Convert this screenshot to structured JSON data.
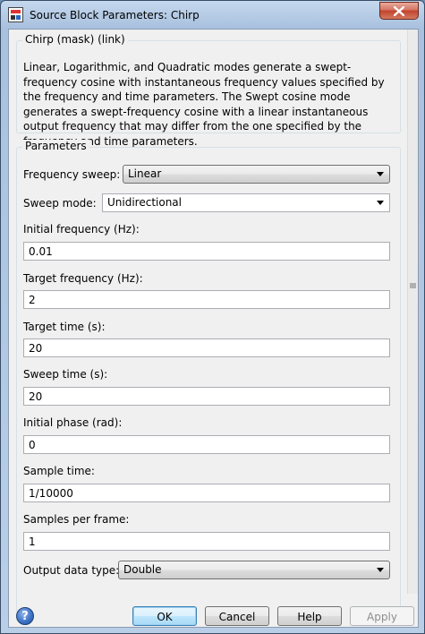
{
  "window": {
    "title": "Source Block Parameters: Chirp",
    "close_label": "×"
  },
  "mask": {
    "legend": "Chirp (mask) (link)",
    "description": "Linear, Logarithmic, and Quadratic modes generate a swept-frequency cosine with instantaneous frequency values specified by the frequency and time parameters.   The Swept cosine mode generates a swept-frequency cosine with a linear instantaneous output frequency that may differ from the one specified by the frequency and time parameters."
  },
  "parameters": {
    "legend": "Parameters",
    "frequency_sweep": {
      "label": "Frequency sweep:",
      "value": "Linear"
    },
    "sweep_mode": {
      "label": "Sweep mode:",
      "value": "Unidirectional"
    },
    "initial_frequency": {
      "label": "Initial frequency (Hz):",
      "value": "0.01"
    },
    "target_frequency": {
      "label": "Target frequency (Hz):",
      "value": "2"
    },
    "target_time": {
      "label": "Target time (s):",
      "value": "20"
    },
    "sweep_time": {
      "label": "Sweep time (s):",
      "value": "20"
    },
    "initial_phase": {
      "label": "Initial phase (rad):",
      "value": "0"
    },
    "sample_time": {
      "label": "Sample time:",
      "value": "1/10000"
    },
    "samples_per_frame": {
      "label": "Samples per frame:",
      "value": "1"
    },
    "output_data_type": {
      "label": "Output data type:",
      "value": "Double"
    }
  },
  "buttons": {
    "ok": "OK",
    "cancel": "Cancel",
    "help": "Help",
    "apply": "Apply",
    "help_icon": "?"
  }
}
